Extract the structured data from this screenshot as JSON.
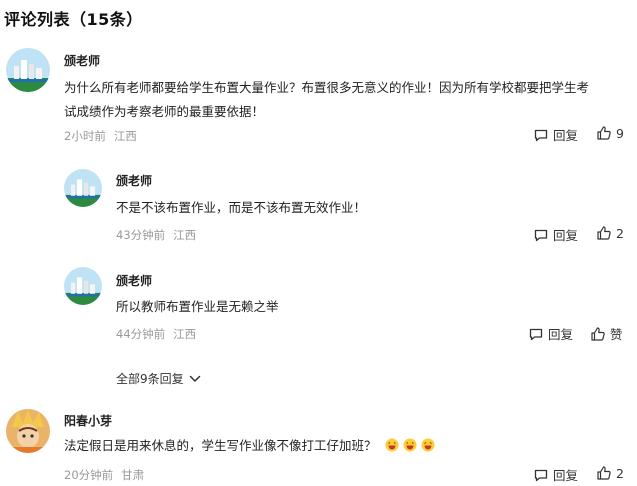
{
  "header": {
    "title": "评论列表（15条）"
  },
  "comments": [
    {
      "author": "颁老师",
      "text_line1": "为什么所有老师都要给学生布置大量作业？布置很多无意义的作业！因为所有学校都要把学生考",
      "text_line2": "试成绩作为考察老师的最重要依据！",
      "time": "2小时前",
      "location": "江西",
      "reply_label": "回复",
      "likes": "9"
    },
    {
      "author": "颁老师",
      "text_line1": "不是不该布置作业，而是不该布置无效作业！",
      "time": "43分钟前",
      "location": "江西",
      "reply_label": "回复",
      "likes": "2"
    },
    {
      "author": "颁老师",
      "text_line1": "所以教师布置作业是无赖之举",
      "time": "44分钟前",
      "location": "江西",
      "reply_label": "回复",
      "likes": "赞"
    },
    {
      "author": "阳春小芽",
      "text_line1": "法定假日是用来休息的，学生写作业像不像打工仔加班？",
      "time": "20分钟前",
      "location": "甘肃",
      "reply_label": "回复",
      "likes": "2"
    }
  ],
  "replies_toggle": {
    "label": "全部9条回复"
  },
  "icons": {
    "reply": "comment-bubble-icon",
    "like": "thumbs-up-icon",
    "expand": "chevron-down-icon",
    "emoji": "laughing-face-emoji"
  }
}
